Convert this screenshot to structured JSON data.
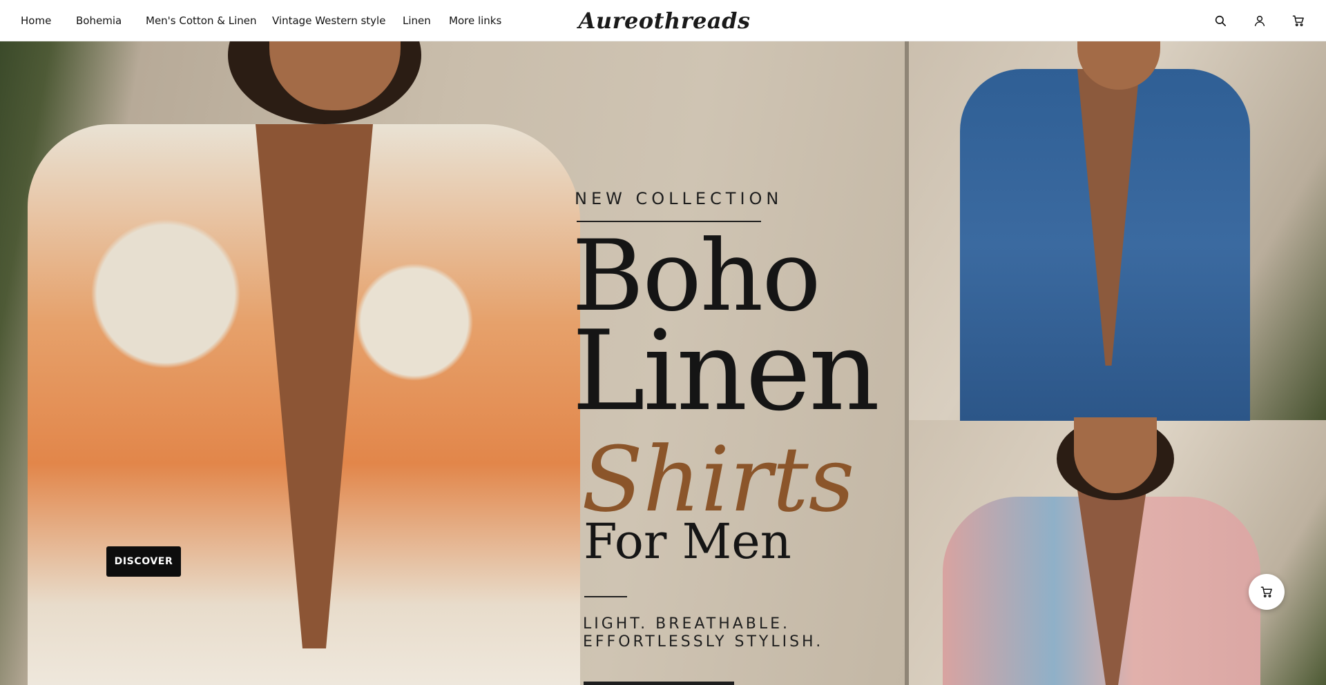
{
  "header": {
    "nav": [
      {
        "label": "Home"
      },
      {
        "label": "Bohemia"
      },
      {
        "label": "Men's Cotton & Linen"
      },
      {
        "label": "Vintage Western style"
      },
      {
        "label": "Linen"
      },
      {
        "label": "More links"
      }
    ],
    "logo": "Aureothreads",
    "icons": [
      "search-icon",
      "account-icon",
      "cart-icon"
    ]
  },
  "hero": {
    "eyebrow": "NEW COLLECTION",
    "title_line1": "Boho",
    "title_line2": "Linen",
    "title_script": "Shirts",
    "title_line4": "For Men",
    "tagline_1": "LIGHT. BREATHABLE.",
    "tagline_2": "EFFORTLESSLY STYLISH.",
    "cta_label": "DISCOVER",
    "colors": {
      "script_brown": "#8b552a",
      "button_bg": "#0d0d0d",
      "text_dark": "#151515"
    }
  },
  "floating": {
    "cart_icon": "cart-icon"
  }
}
